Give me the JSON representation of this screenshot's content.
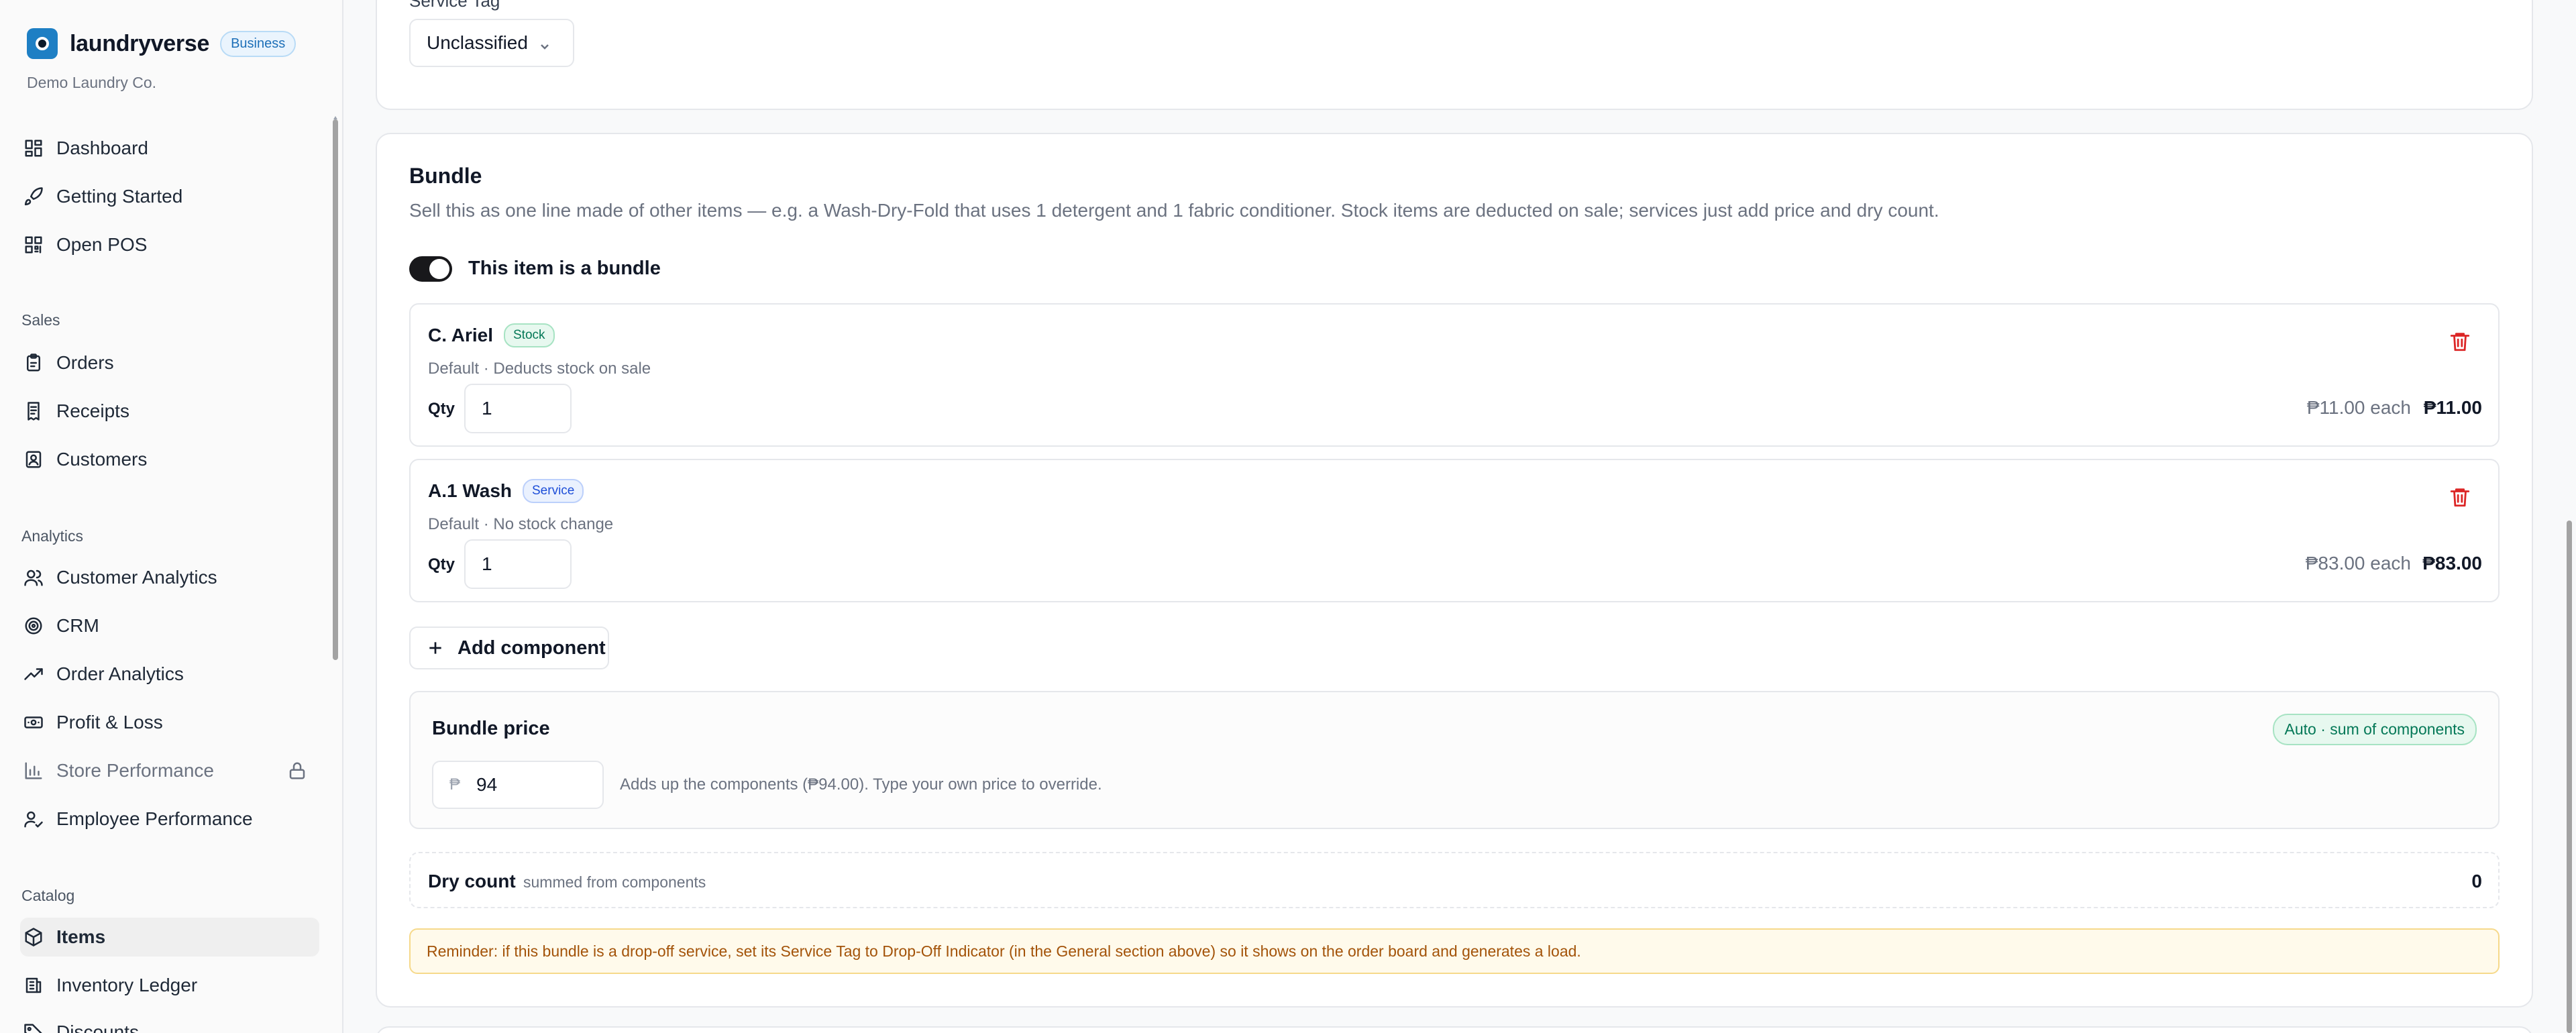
{
  "brand": {
    "name": "laundryverse",
    "plan_badge": "Business",
    "org": "Demo Laundry Co."
  },
  "sidebar": {
    "top_items": [
      {
        "label": "Dashboard",
        "icon": "grid-icon"
      },
      {
        "label": "Getting Started",
        "icon": "rocket-icon"
      },
      {
        "label": "Open POS",
        "icon": "qr-icon"
      }
    ],
    "sections": [
      {
        "title": "Sales",
        "items": [
          {
            "label": "Orders",
            "icon": "clipboard-icon"
          },
          {
            "label": "Receipts",
            "icon": "receipt-icon"
          },
          {
            "label": "Customers",
            "icon": "contact-icon"
          }
        ]
      },
      {
        "title": "Analytics",
        "items": [
          {
            "label": "Customer Analytics",
            "icon": "users-icon"
          },
          {
            "label": "CRM",
            "icon": "target-icon"
          },
          {
            "label": "Order Analytics",
            "icon": "trending-up-icon"
          },
          {
            "label": "Profit & Loss",
            "icon": "banknote-icon"
          },
          {
            "label": "Store Performance",
            "icon": "bar-chart-icon",
            "locked": true
          },
          {
            "label": "Employee Performance",
            "icon": "user-check-icon"
          }
        ]
      },
      {
        "title": "Catalog",
        "items": [
          {
            "label": "Items",
            "icon": "package-icon",
            "active": true
          },
          {
            "label": "Inventory Ledger",
            "icon": "ledger-icon"
          },
          {
            "label": "Discounts",
            "icon": "tag-icon"
          }
        ]
      }
    ]
  },
  "general": {
    "service_tag_label": "Service Tag",
    "service_tag_value": "Unclassified"
  },
  "bundle": {
    "title": "Bundle",
    "description": "Sell this as one line made of other items — e.g. a Wash-Dry-Fold that uses 1 detergent and 1 fabric conditioner. Stock items are deducted on sale; services just add price and dry count.",
    "toggle_label": "This item is a bundle",
    "toggle_on": true,
    "components": [
      {
        "name": "C. Ariel",
        "type": "Stock",
        "sub": "Default · Deducts stock on sale",
        "qty_label": "Qty",
        "qty": "1",
        "each": "₱11.00 each",
        "total": "₱11.00"
      },
      {
        "name": "A.1 Wash",
        "type": "Service",
        "sub": "Default · No stock change",
        "qty_label": "Qty",
        "qty": "1",
        "each": "₱83.00 each",
        "total": "₱83.00"
      }
    ],
    "add_component_label": "Add component",
    "price": {
      "title": "Bundle price",
      "auto_badge": "Auto · sum of components",
      "currency": "₱",
      "value": "94",
      "hint": "Adds up the components (₱94.00). Type your own price to override."
    },
    "dry_count": {
      "title": "Dry count",
      "sub": "summed from components",
      "value": "0"
    },
    "reminder": "Reminder: if this bundle is a drop-off service, set its Service Tag to Drop-Off Indicator (in the General section above) so it shows on the order board and generates a load."
  },
  "colors": {
    "accent": "#1e7fc4",
    "danger": "#dc2626",
    "success": "#047857",
    "warning_text": "#a35309"
  }
}
